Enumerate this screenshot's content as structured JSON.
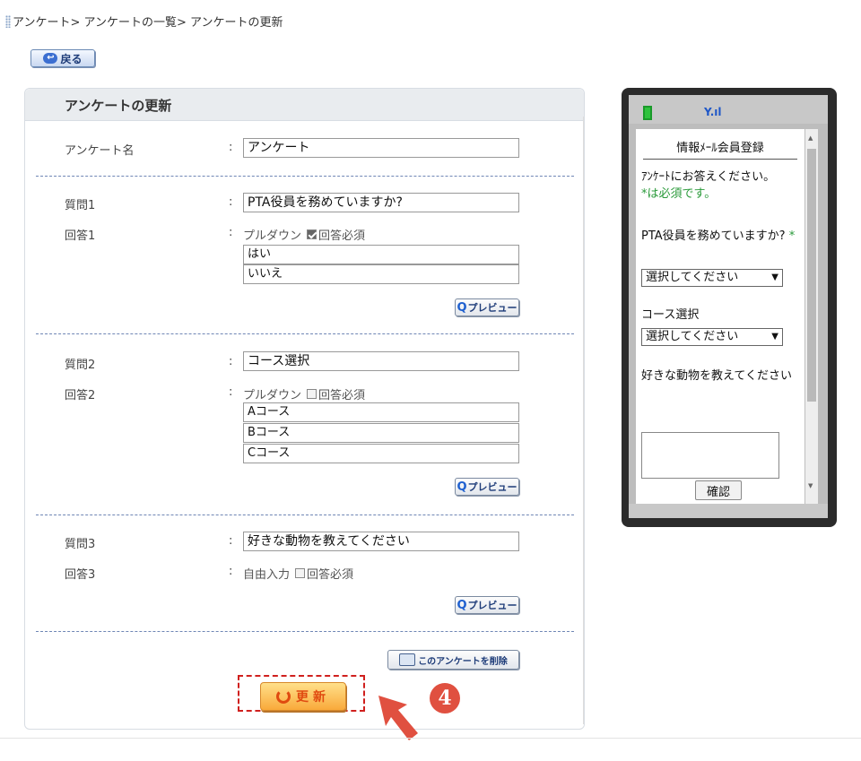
{
  "breadcrumb": "アンケート> アンケートの一覧> アンケートの更新",
  "back_label": "戻る",
  "panel_title": "アンケートの更新",
  "colon": ":",
  "survey_name": {
    "label": "アンケート名",
    "value": "アンケート"
  },
  "questions": [
    {
      "q_label": "質問1",
      "q_value": "PTA役員を務めていますか?",
      "a_label": "回答1",
      "type": "プルダウン",
      "required_label": "回答必須",
      "required": true,
      "options": [
        "はい",
        "いいえ"
      ]
    },
    {
      "q_label": "質問2",
      "q_value": "コース選択",
      "a_label": "回答2",
      "type": "プルダウン",
      "required_label": "回答必須",
      "required": false,
      "options": [
        "Aコース",
        "Bコース",
        "Cコース"
      ]
    },
    {
      "q_label": "質問3",
      "q_value": "好きな動物を教えてください",
      "a_label": "回答3",
      "type": "自由入力",
      "required_label": "回答必須",
      "required": false,
      "options": []
    }
  ],
  "preview_label": "プレビュー",
  "preview_q": "Q",
  "delete_label": "このアンケートを削除",
  "update_label": "更新",
  "step_badge": "4",
  "phone": {
    "title": "情報ﾒｰﾙ会員登録",
    "intro": "ｱﾝｹｰﾄにお答えください。",
    "required_note": "*は必須です。",
    "q1": "PTA役員を務めていますか?",
    "q1_mark": "*",
    "select_placeholder": "選択してください",
    "q2": "コース選択",
    "q3": "好きな動物を教えてください",
    "confirm": "確認"
  },
  "colors": {
    "accent": "#1d3b78",
    "update": "#e04a10",
    "highlight": "#d0201e",
    "badge": "#e05040",
    "required": "#2a9a3a"
  }
}
